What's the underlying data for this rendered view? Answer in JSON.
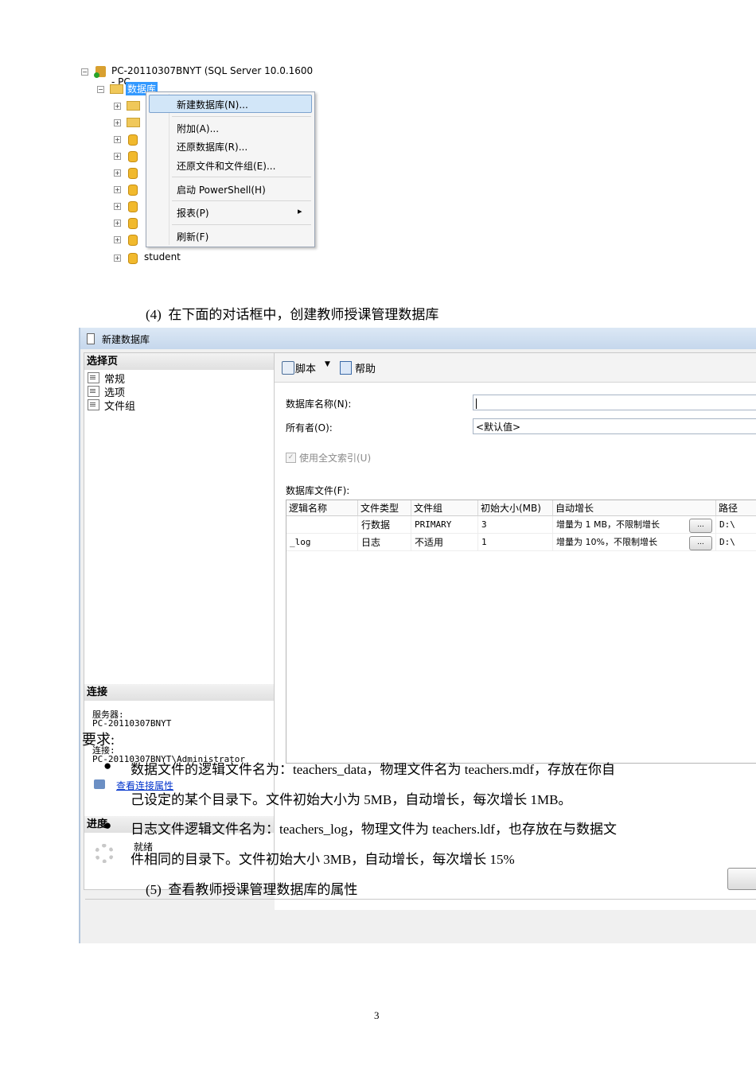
{
  "tree": {
    "server_label": "PC-20110307BNYT (SQL Server 10.0.1600 - PC-",
    "databases_label": "数据库",
    "last_db_label": "student"
  },
  "context_menu": {
    "items": [
      "新建数据库(N)...",
      "附加(A)...",
      "还原数据库(R)...",
      "还原文件和文件组(E)...",
      "启动 PowerShell(H)",
      "报表(P)",
      "刷新(F)"
    ],
    "submenu_arrow": "▸"
  },
  "step4": {
    "number": "(4)",
    "text": "在下面的对话框中，创建教师授课管理数据库"
  },
  "dialog": {
    "title": "新建数据库",
    "select_page_header": "选择页",
    "pages": [
      "常规",
      "选项",
      "文件组"
    ],
    "connection_header": "连接",
    "server_label": "服务器:",
    "server_value": "PC-20110307BNYT",
    "connection_label": "连接:",
    "connection_value": "PC-20110307BNYT\\Administrator",
    "view_connection_link": "查看连接属性",
    "progress_header": "进度",
    "progress_status": "就绪",
    "toolbar": {
      "script": "脚本",
      "help": "帮助"
    },
    "db_name_label": "数据库名称(N):",
    "db_name_value": "",
    "owner_label": "所有者(O):",
    "owner_value": "<默认值>",
    "fulltext_label": "使用全文索引(U)",
    "db_files_label": "数据库文件(F):",
    "columns": [
      "逻辑名称",
      "文件类型",
      "文件组",
      "初始大小(MB)",
      "自动增长",
      "路径"
    ],
    "rows": [
      [
        "",
        "行数据",
        "PRIMARY",
        "3",
        "增量为 1 MB，不限制增长",
        "D:\\"
      ],
      [
        "_log",
        "日志",
        "不适用",
        "1",
        "增量为 10%，不限制增长",
        "D:\\"
      ]
    ],
    "ellipsis": "..."
  },
  "requirements": {
    "title": "要求:",
    "bullets": [
      [
        "数据文件的逻辑文件名为：teachers_data，物理文件名为 teachers.mdf，存放在你自",
        "己设定的某个目录下。文件初始大小为 5MB，自动增长，每次增长 1MB。"
      ],
      [
        "日志文件逻辑文件名为：teachers_log，物理文件为 teachers.ldf，也存放在与数据文",
        "件相同的目录下。文件初始大小 3MB，自动增长，每次增长 15%"
      ]
    ]
  },
  "step5": {
    "number": "(5)",
    "text": "查看教师授课管理数据库的属性"
  },
  "page_number": "3"
}
